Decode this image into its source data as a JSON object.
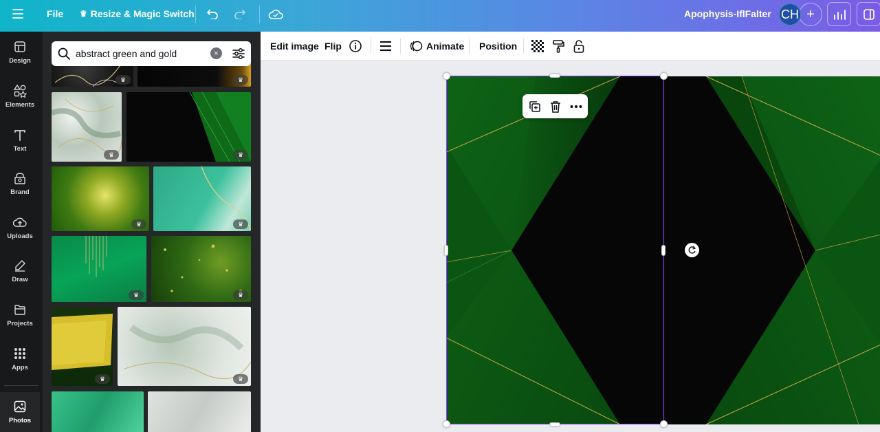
{
  "topbar": {
    "file_label": "File",
    "resize_label": "Resize & Magic Switch",
    "doc_title": "Apophysis-IflFalter",
    "avatar_initials": "CH",
    "add_label": "+"
  },
  "rail": {
    "items": [
      {
        "label": "Design",
        "icon": "design-icon"
      },
      {
        "label": "Elements",
        "icon": "elements-icon"
      },
      {
        "label": "Text",
        "icon": "text-icon"
      },
      {
        "label": "Brand",
        "icon": "brand-icon"
      },
      {
        "label": "Uploads",
        "icon": "uploads-icon"
      },
      {
        "label": "Draw",
        "icon": "draw-icon"
      },
      {
        "label": "Projects",
        "icon": "projects-icon"
      },
      {
        "label": "Apps",
        "icon": "apps-icon"
      },
      {
        "label": "Photos",
        "icon": "photos-icon",
        "active": true
      }
    ]
  },
  "search": {
    "value": "abstract green and gold",
    "clear_label": "×"
  },
  "photos": [
    {
      "name": "marble-black-gold"
    },
    {
      "name": "dark-gold-sparkle"
    },
    {
      "name": "green-marble-ink"
    },
    {
      "name": "black-green-stripes"
    },
    {
      "name": "green-gold-glow"
    },
    {
      "name": "teal-gold-marble"
    },
    {
      "name": "green-gold-drips"
    },
    {
      "name": "green-bokeh-gold"
    },
    {
      "name": "gold-paint-dark-green"
    },
    {
      "name": "sage-marble-gold"
    },
    {
      "name": "emerald-ink"
    },
    {
      "name": "grey-marble-gold"
    }
  ],
  "toolbar": {
    "edit_image": "Edit image",
    "flip": "Flip",
    "animate": "Animate",
    "position": "Position"
  },
  "colors": {
    "accent_purple": "#8b3dff",
    "gradient_start": "#0fb5c9",
    "gradient_end": "#7a5ce6",
    "design_green": "#0d5c12",
    "gold_line": "#c9a84a"
  }
}
